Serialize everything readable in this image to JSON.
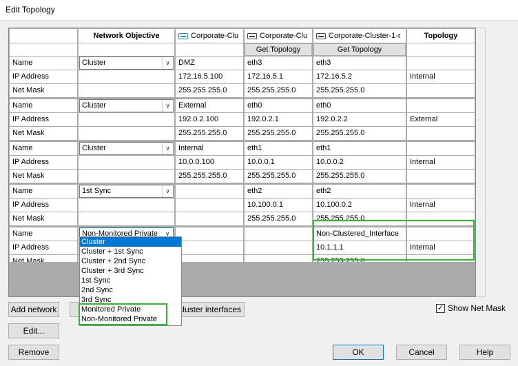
{
  "window": {
    "title": "Edit Topology"
  },
  "columns": {
    "network_objective": "Network Objective",
    "member1": "Corporate-Clu",
    "member2": "Corporate-Clu",
    "member3": "Corporate-Cluster-1-r",
    "topology": "Topology",
    "get_topology": "Get Topology"
  },
  "row_labels": {
    "name": "Name",
    "ip": "IP Address",
    "mask": "Net Mask"
  },
  "groups": [
    {
      "objective": "Cluster",
      "cluster": [
        "DMZ",
        "172.16.5.100",
        "255.255.255.0"
      ],
      "m2": [
        "eth3",
        "172.16.5.1",
        "255.255.255.0"
      ],
      "m3": [
        "eth3",
        "172.16.5.2",
        "255.255.255.0"
      ],
      "topology": "Internal"
    },
    {
      "objective": "Cluster",
      "cluster": [
        "External",
        "192.0.2.100",
        "255.255.255.0"
      ],
      "m2": [
        "eth0",
        "192.0.2.1",
        "255.255.255.0"
      ],
      "m3": [
        "eth0",
        "192.0.2.2",
        "255.255.255.0"
      ],
      "topology": "External"
    },
    {
      "objective": "Cluster",
      "cluster": [
        "Internal",
        "10.0.0.100",
        "255.255.255.0"
      ],
      "m2": [
        "eth1",
        "10.0.0.1",
        "255.255.255.0"
      ],
      "m3": [
        "eth1",
        "10.0.0.2",
        "255.255.255.0"
      ],
      "topology": "Internal"
    },
    {
      "objective": "1st Sync",
      "cluster": [
        "",
        "",
        ""
      ],
      "m2": [
        "eth2",
        "10.100.0.1",
        "255.255.255.0"
      ],
      "m3": [
        "eth2",
        "10.100.0.2",
        "255.255.255.0"
      ],
      "topology": "Internal"
    },
    {
      "objective": "Non-Monitored Private",
      "cluster": [
        "",
        "",
        ""
      ],
      "m2": [
        "",
        "",
        ""
      ],
      "m3": [
        "Non-Clustered_Interface",
        "10.1.1.1",
        "255.255.255.0"
      ],
      "topology": "Internal"
    }
  ],
  "dropdown_options": [
    "Cluster",
    "Cluster + 1st Sync",
    "Cluster + 2nd Sync",
    "Cluster + 3rd Sync",
    "1st Sync",
    "2nd Sync",
    "3rd Sync",
    "Monitored Private",
    "Non-Monitored Private"
  ],
  "dropdown_selected": "Cluster",
  "buttons": {
    "add_network": "Add network",
    "copy_cluster": "p cluster interfaces",
    "edit": "Edit...",
    "remove": "Remove",
    "ok": "OK",
    "cancel": "Cancel",
    "help": "Help"
  },
  "show_net_mask": {
    "label": "Show Net Mask",
    "checked": true,
    "mark": "✓"
  },
  "colors": {
    "selection": "#0078d7",
    "highlight_green": "#2eb82e",
    "cluster_icon": "#1e8fd6"
  }
}
